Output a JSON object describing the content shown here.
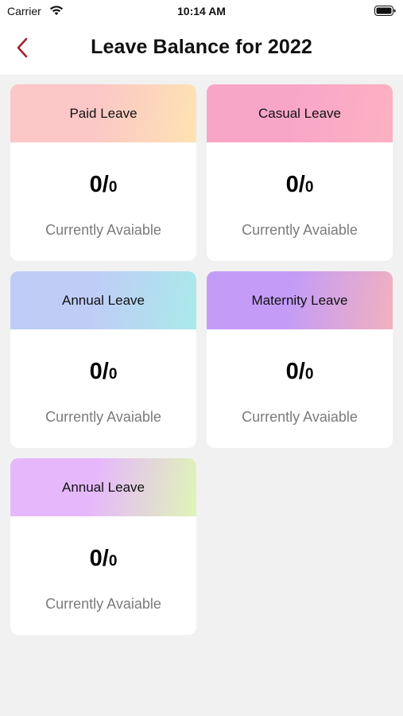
{
  "status_bar": {
    "carrier": "Carrier",
    "time": "10:14 AM",
    "wifi_icon": "wifi-icon",
    "battery_icon": "battery-icon"
  },
  "nav": {
    "back_icon": "chevron-left-icon",
    "back_color": "#a3232f",
    "title": "Leave Balance for 2022"
  },
  "cards": [
    {
      "name": "Paid Leave",
      "used": "0",
      "total": "0",
      "status": "Currently Avaiable",
      "gradient": [
        "#fcc7c7",
        "#fde3b2"
      ]
    },
    {
      "name": "Casual Leave",
      "used": "0",
      "total": "0",
      "status": "Currently Avaiable",
      "gradient": [
        "#f8a6c8",
        "#fcb1c2"
      ]
    },
    {
      "name": "Annual Leave",
      "used": "0",
      "total": "0",
      "status": "Currently Avaiable",
      "gradient": [
        "#bfcdf6",
        "#a9eaea"
      ]
    },
    {
      "name": "Maternity Leave",
      "used": "0",
      "total": "0",
      "status": "Currently Avaiable",
      "gradient": [
        "#c49cf7",
        "#f2b1be"
      ]
    },
    {
      "name": "Annual Leave",
      "used": "0",
      "total": "0",
      "status": "Currently Avaiable",
      "gradient": [
        "#e6b8fb",
        "#dff5b7"
      ]
    }
  ]
}
